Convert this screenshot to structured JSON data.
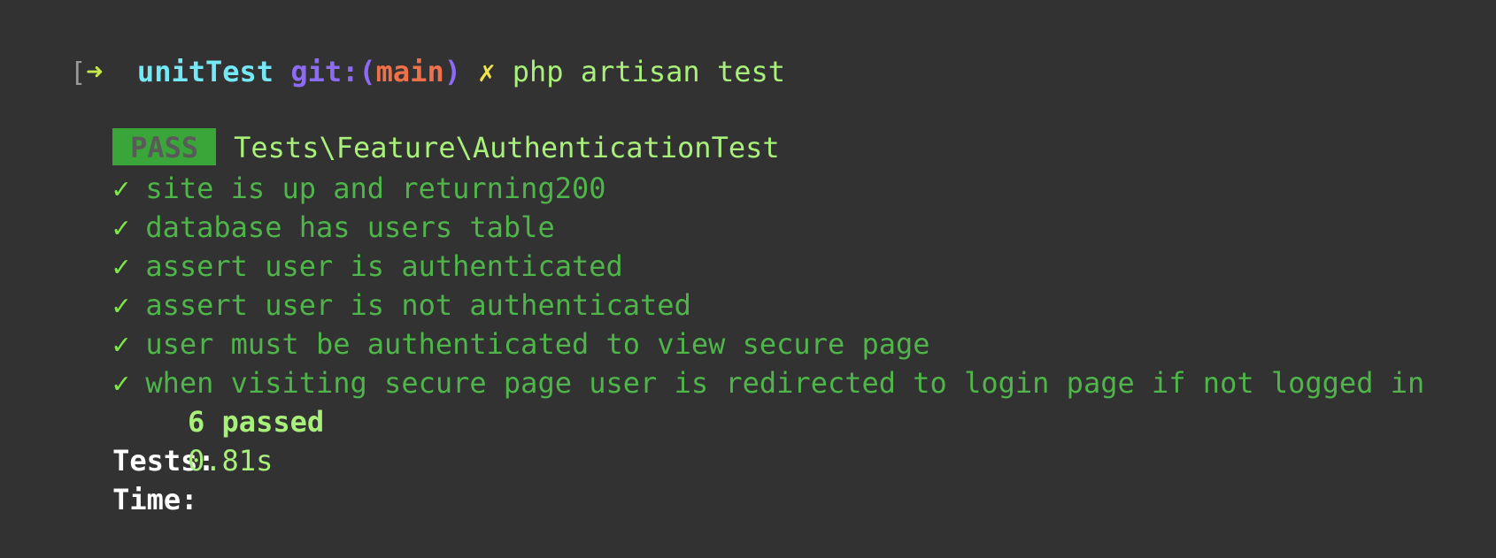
{
  "prompt": {
    "bracket": "[",
    "arrow": "➜",
    "directory": "unitTest",
    "git_prefix": "git:",
    "paren_open": "(",
    "branch": "main",
    "paren_close": ")",
    "dirty_mark": "✗",
    "command": "php artisan test"
  },
  "suite": {
    "status": "PASS",
    "name": "Tests\\Feature\\AuthenticationTest"
  },
  "tests": [
    {
      "mark": "✓",
      "name": "site is up and returning200"
    },
    {
      "mark": "✓",
      "name": "database has users table"
    },
    {
      "mark": "✓",
      "name": "assert user is authenticated"
    },
    {
      "mark": "✓",
      "name": "assert user is not authenticated"
    },
    {
      "mark": "✓",
      "name": "user must be authenticated to view secure page"
    },
    {
      "mark": "✓",
      "name": "when visiting secure page user is redirected to login page if not logged in"
    }
  ],
  "summary": {
    "tests_label": "Tests:",
    "tests_value": "6 passed",
    "time_label": "Time:",
    "time_value": "0.81s"
  },
  "colors": {
    "background": "#323232",
    "pass_badge": "#3aa63a",
    "check": "#7ee84a",
    "test_text": "#4fb54a"
  }
}
